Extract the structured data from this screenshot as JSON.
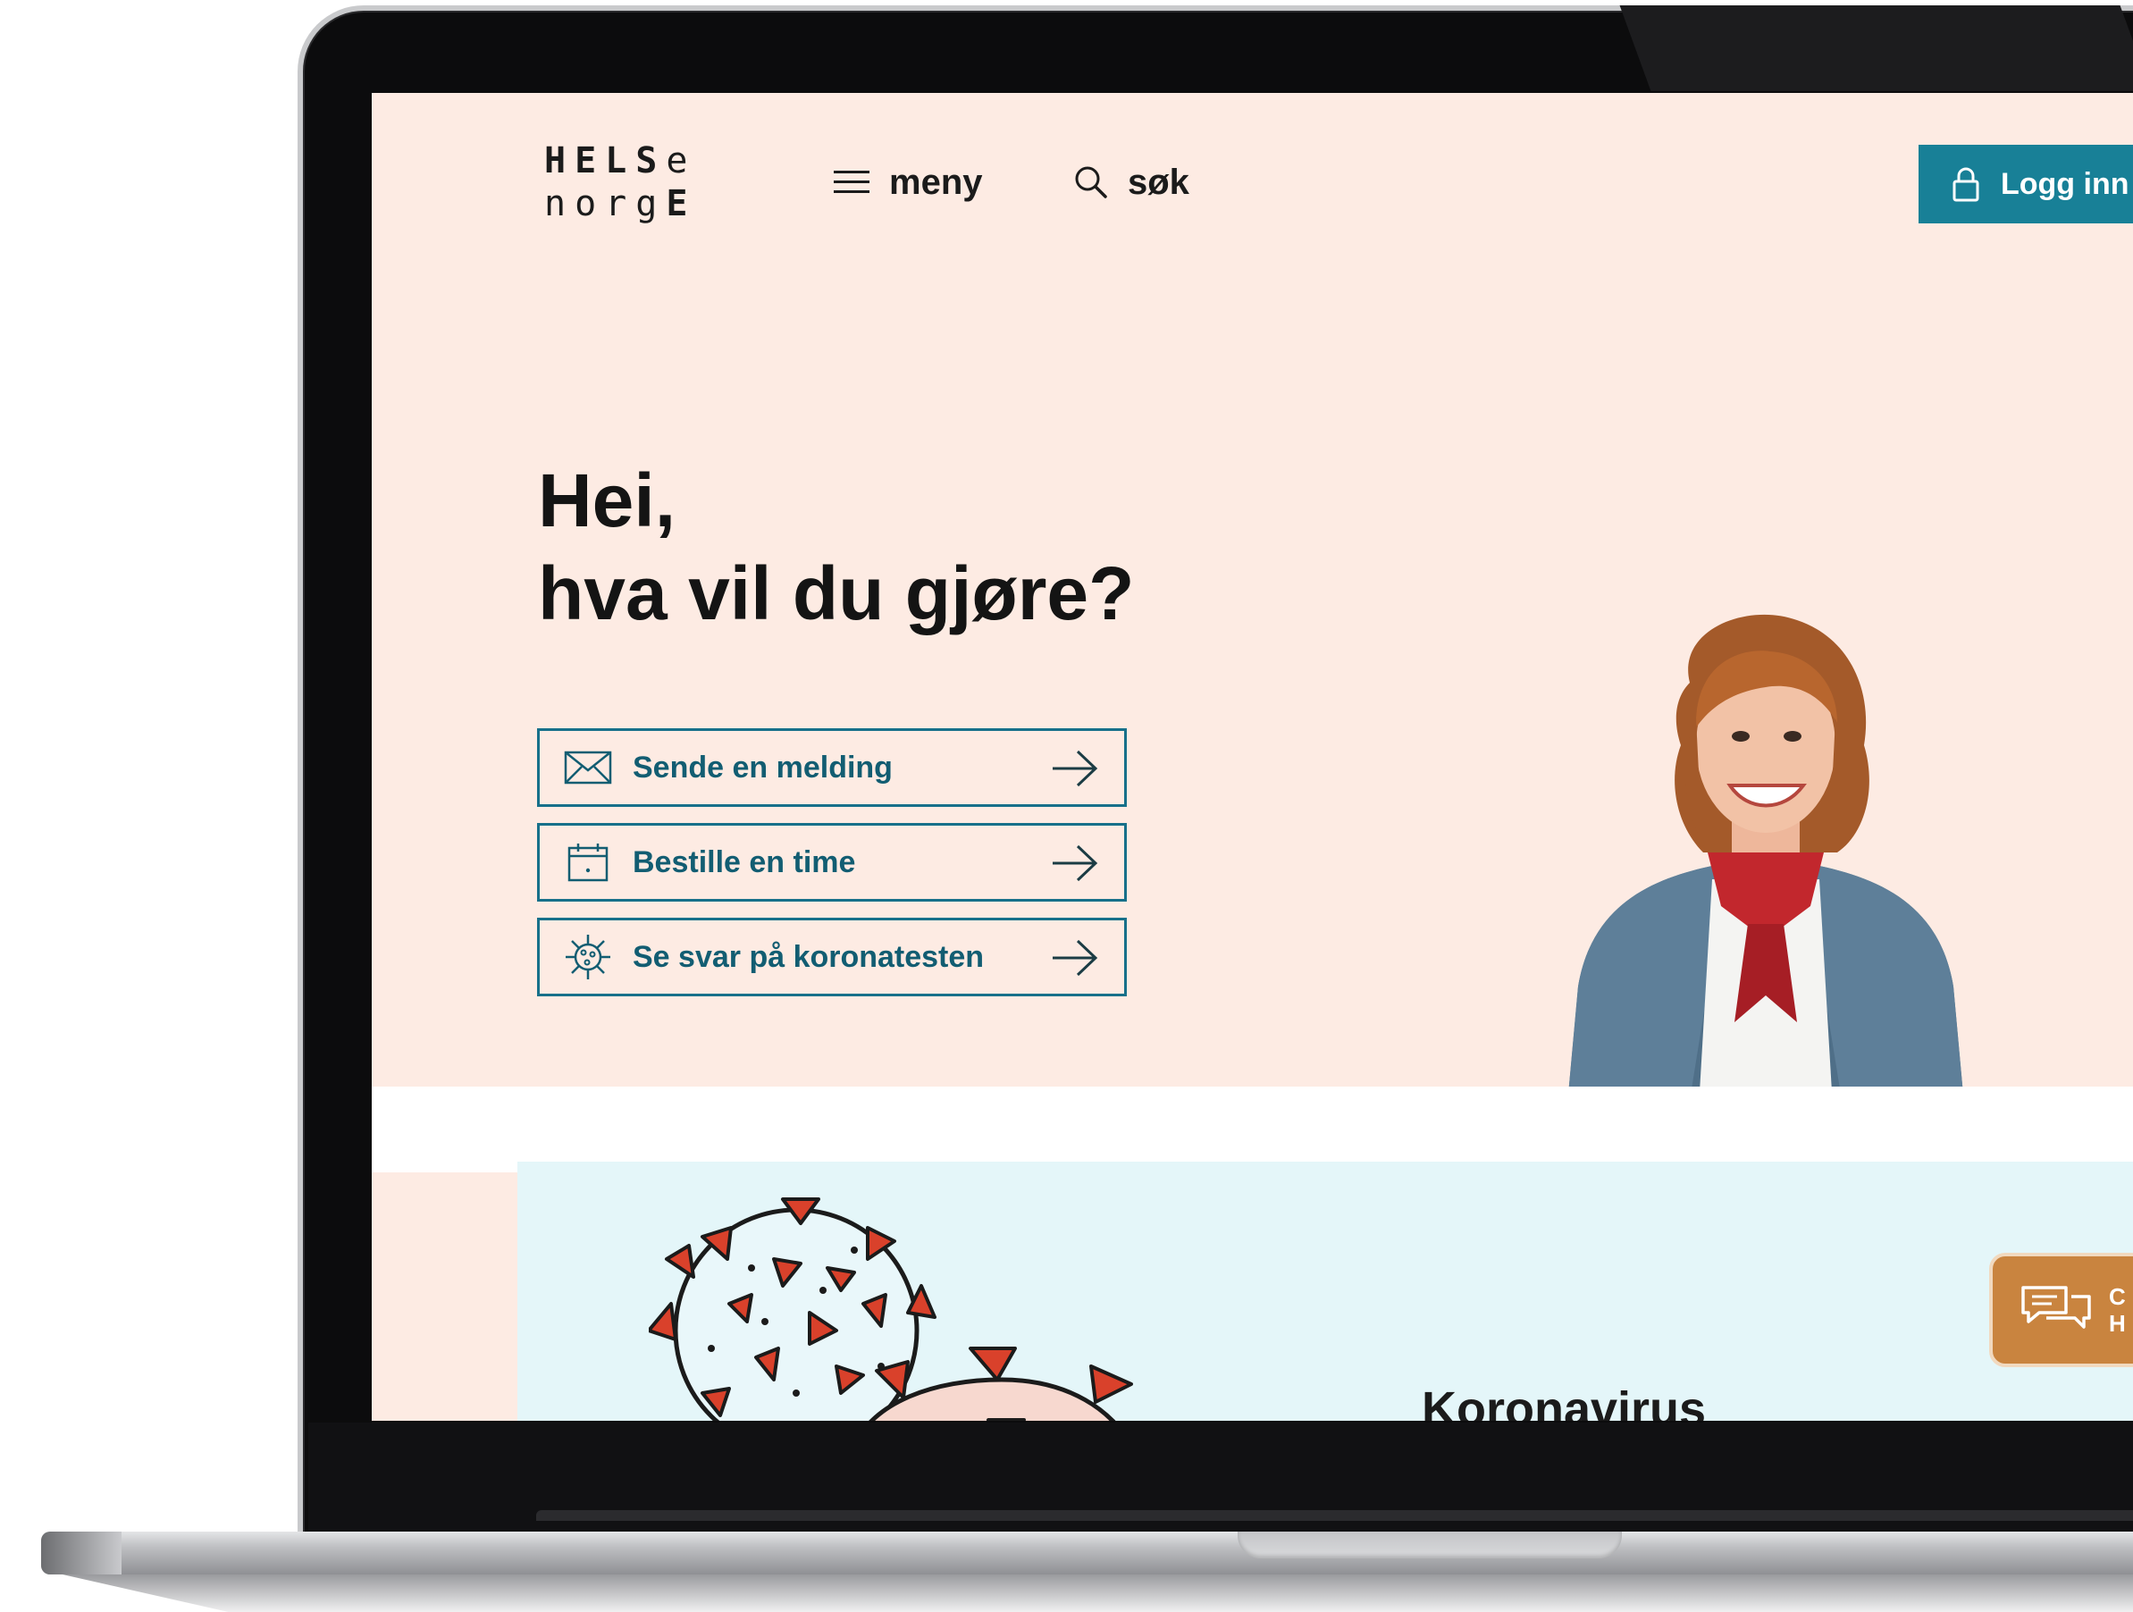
{
  "header": {
    "logo": {
      "line1_bold": "HELS",
      "line1_light": "e",
      "line2_light": "norg",
      "line2_bold": "E"
    },
    "menu_label": "meny",
    "search_label": "søk",
    "login_label": "Logg inn"
  },
  "hero": {
    "title_line1": "Hei,",
    "title_line2": "hva vil du gjøre?",
    "actions": [
      {
        "label": "Sende en melding",
        "icon": "envelope-icon"
      },
      {
        "label": "Bestille en time",
        "icon": "calendar-icon"
      },
      {
        "label": "Se svar på koronatesten",
        "icon": "virus-icon"
      }
    ]
  },
  "covid_section": {
    "heading": "Koronavirus",
    "illustration": "coronavirus-illustration"
  },
  "chat": {
    "icon": "chat-bubbles-icon",
    "peek_line1": "C",
    "peek_line2": "H"
  },
  "colors": {
    "hero_background": "#fdebe3",
    "brand_teal": "#188097",
    "action_text": "#125d72",
    "covid_panel": "#e4f6f9",
    "virus_red": "#d9412b",
    "chat_button": "#c9843f"
  }
}
